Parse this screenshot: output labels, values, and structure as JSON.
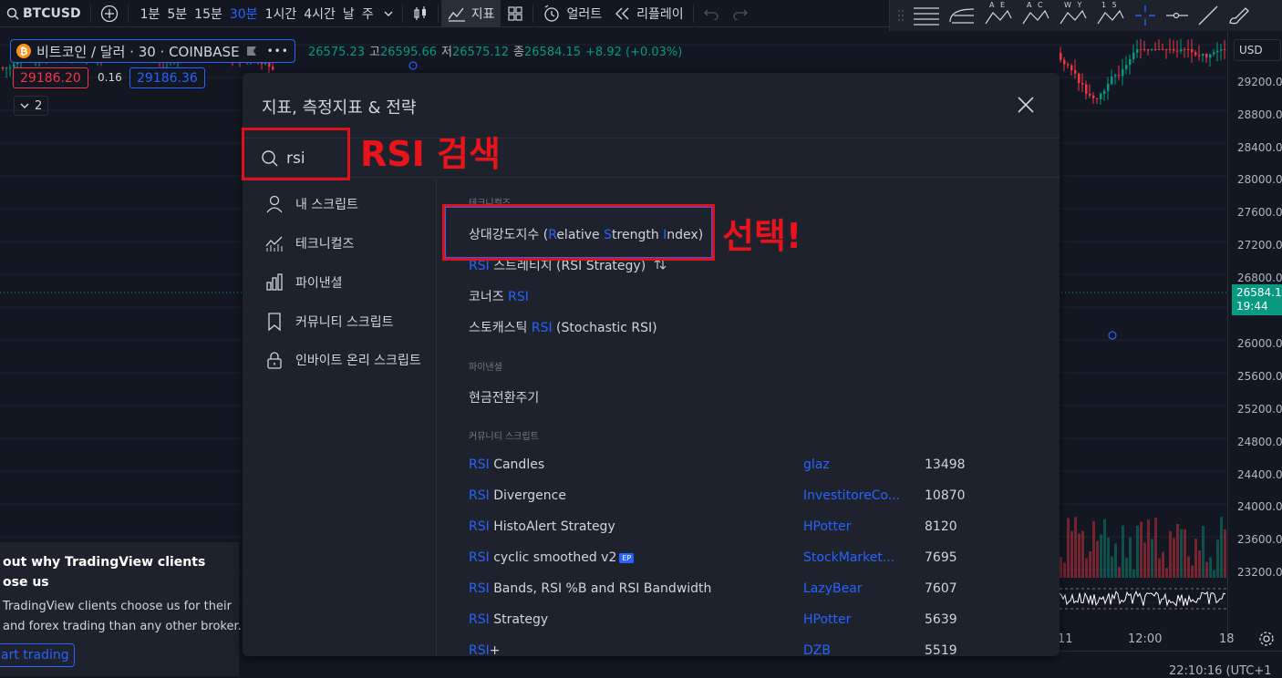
{
  "toolbar": {
    "symbol": "BTCUSD",
    "timeframes": [
      "1분",
      "5분",
      "15분",
      "30분",
      "1시간",
      "4시간",
      "날",
      "주"
    ],
    "active_timeframe_index": 3,
    "indicators_label": "지표",
    "alert_label": "얼러트",
    "replay_label": "리플레이",
    "draw_tool_letters": [
      "A E",
      "A C",
      "W Y",
      "1 5"
    ]
  },
  "legend": {
    "symbol_text": "비트코인 / 달러 · 30 · COINBASE",
    "more": "•••",
    "ohlc": [
      {
        "k": "",
        "v": "26575.23"
      },
      {
        "k": "고",
        "v": "26595.66"
      },
      {
        "k": "저",
        "v": "26575.12"
      },
      {
        "k": "종",
        "v": "26584.15"
      },
      {
        "k": "",
        "v": "+8.92 (+0.03%)"
      }
    ],
    "bid": "29186.20",
    "spread": "0.16",
    "ask": "29186.36",
    "collapse": "2"
  },
  "price_axis": {
    "currency": "USD",
    "ticks": [
      "29200.00",
      "28800.00",
      "28400.00",
      "28000.00",
      "27600.00",
      "27200.00",
      "26800.00",
      "26000.00",
      "25600.00",
      "25200.00",
      "24800.00",
      "24400.00",
      "24000.00",
      "23600.00",
      "23200.00"
    ],
    "last_price": "26584.1",
    "countdown": "19:44"
  },
  "time_axis": {
    "labels": [
      "11",
      "12:00",
      "18"
    ]
  },
  "status": {
    "clock": "22:10:16 (UTC+1"
  },
  "promo": {
    "title_line1": "out why TradingView clients",
    "title_line2": "ose us",
    "body_line1": "TradingView clients choose us for their",
    "body_line2": "and forex trading than any other broker.",
    "cta": "art trading"
  },
  "modal": {
    "title": "지표, 측정지표 & 전략",
    "search_value": "rsi",
    "nav": [
      "내 스크립트",
      "테크니컬즈",
      "파이낸셜",
      "커뮤니티 스크립트",
      "인바이트 온리 스크립트"
    ],
    "sections": {
      "technicals": "테크니컬즈",
      "financials": "파이낸셜",
      "community": "커뮤니티 스크립트"
    },
    "technicals": [
      {
        "pre": "상대강도지수 (",
        "parts": [
          [
            "R",
            "elative "
          ],
          [
            "S",
            "trength "
          ],
          [
            "I",
            "ndex)"
          ]
        ]
      },
      {
        "hl": "RSI",
        "rest": " 스트레티지 (RSI Strategy)"
      },
      {
        "pre": "코너즈 ",
        "hl": "RSI",
        "rest": ""
      },
      {
        "pre": "스토캐스틱 ",
        "hl": "RSI",
        "rest": " (Stochastic RSI)"
      }
    ],
    "financials": [
      "현금전환주기"
    ],
    "community": [
      {
        "hl": "RSI",
        "rest": " Candles",
        "author": "glaz",
        "count": "13498"
      },
      {
        "hl": "RSI",
        "rest": " Divergence",
        "author": "InvestitoreCo...",
        "count": "10870"
      },
      {
        "hl": "RSI",
        "rest": " HistoAlert Strategy",
        "author": "HPotter",
        "count": "8120"
      },
      {
        "hl": "RSI",
        "rest": " cyclic smoothed v2",
        "badge": "EP",
        "author": "StockMarket...",
        "count": "7695"
      },
      {
        "hl": "RSI",
        "rest": " Bands, RSI %B and RSI Bandwidth",
        "author": "LazyBear",
        "count": "7607"
      },
      {
        "hl": "RSI",
        "rest": " Strategy",
        "author": "HPotter",
        "count": "5639"
      },
      {
        "hl": "RSI",
        "rest": "+",
        "author": "DZB",
        "count": "5519"
      }
    ]
  },
  "annotations": {
    "search": "RSI 검색",
    "select": "선택!"
  },
  "colors": {
    "accent": "#2962ff",
    "annotation": "#e0111a",
    "up": "#089981",
    "down": "#f23645"
  }
}
